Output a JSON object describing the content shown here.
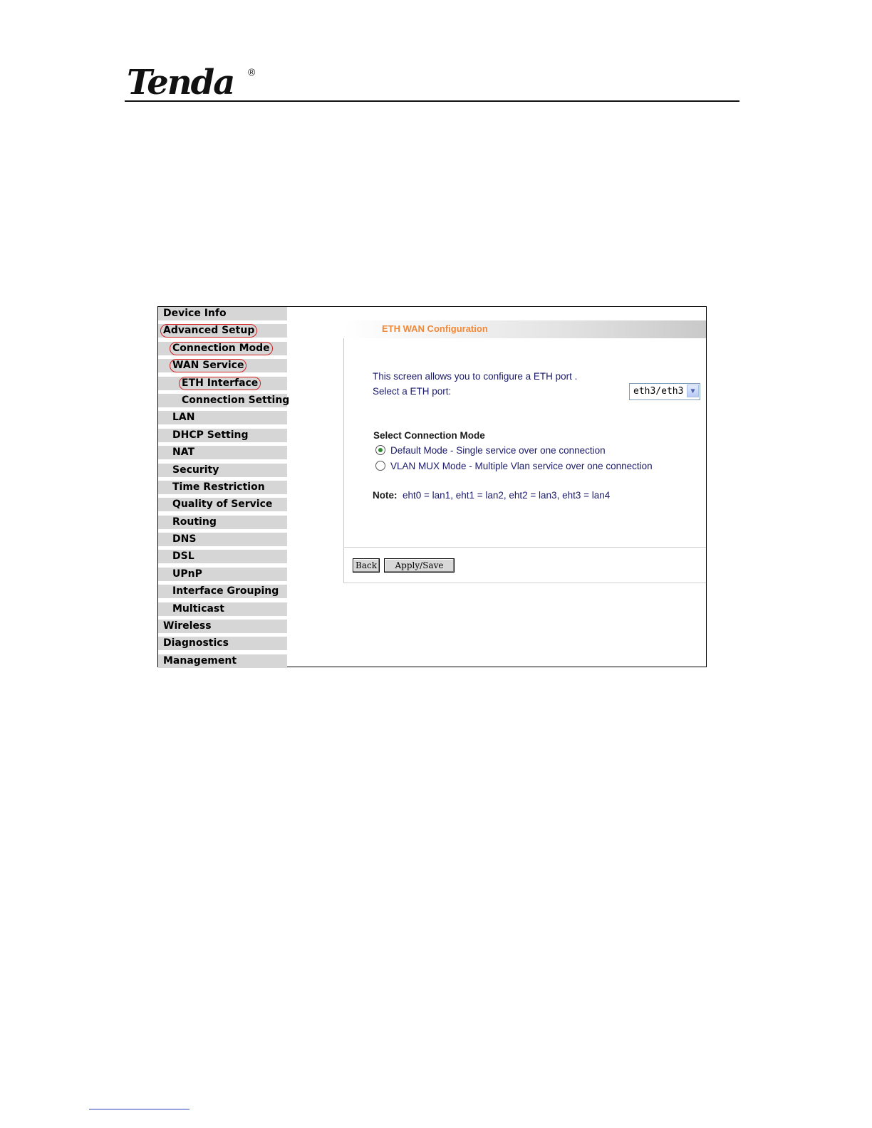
{
  "brand": {
    "name": "Tenda",
    "registered": "®"
  },
  "sidebar": {
    "items": [
      {
        "label": "Device Info",
        "level": 0,
        "circled": false
      },
      {
        "label": "Advanced Setup",
        "level": 0,
        "circled": true
      },
      {
        "label": "Connection Mode",
        "level": 1,
        "circled": true
      },
      {
        "label": "WAN Service",
        "level": 1,
        "circled": true
      },
      {
        "label": "ETH Interface",
        "level": 2,
        "circled": true
      },
      {
        "label": "Connection Setting",
        "level": 2,
        "circled": false
      },
      {
        "label": "LAN",
        "level": 1,
        "circled": false
      },
      {
        "label": "DHCP Setting",
        "level": 1,
        "circled": false
      },
      {
        "label": "NAT",
        "level": 1,
        "circled": false
      },
      {
        "label": "Security",
        "level": 1,
        "circled": false
      },
      {
        "label": "Time Restriction",
        "level": 1,
        "circled": false
      },
      {
        "label": "Quality of Service",
        "level": 1,
        "circled": false
      },
      {
        "label": "Routing",
        "level": 1,
        "circled": false
      },
      {
        "label": "DNS",
        "level": 1,
        "circled": false
      },
      {
        "label": "DSL",
        "level": 1,
        "circled": false
      },
      {
        "label": "UPnP",
        "level": 1,
        "circled": false
      },
      {
        "label": "Interface Grouping",
        "level": 1,
        "circled": false
      },
      {
        "label": "Multicast",
        "level": 1,
        "circled": false
      },
      {
        "label": "Wireless",
        "level": 0,
        "circled": false
      },
      {
        "label": "Diagnostics",
        "level": 0,
        "circled": false
      },
      {
        "label": "Management",
        "level": 0,
        "circled": false
      }
    ]
  },
  "main": {
    "title": "ETH WAN Configuration",
    "intro": "This screen allows you to configure a ETH port .",
    "port_label": "Select a ETH port:",
    "port_select": {
      "value": "eth3/eth3"
    },
    "mode_heading": "Select Connection Mode",
    "modes": [
      {
        "label": "Default Mode - Single service over one connection",
        "checked": true
      },
      {
        "label": "VLAN MUX Mode - Multiple Vlan service over one connection",
        "checked": false
      }
    ],
    "note_label": "Note:",
    "note_text": "eht0 = lan1, eht1 = lan2, eht2 = lan3, eht3 = lan4",
    "buttons": {
      "back": "Back",
      "apply": "Apply/Save"
    }
  },
  "colors": {
    "title_text": "#f08a3a",
    "highlight_circle": "#d42020",
    "radio_checked": "#2d8a2d"
  }
}
